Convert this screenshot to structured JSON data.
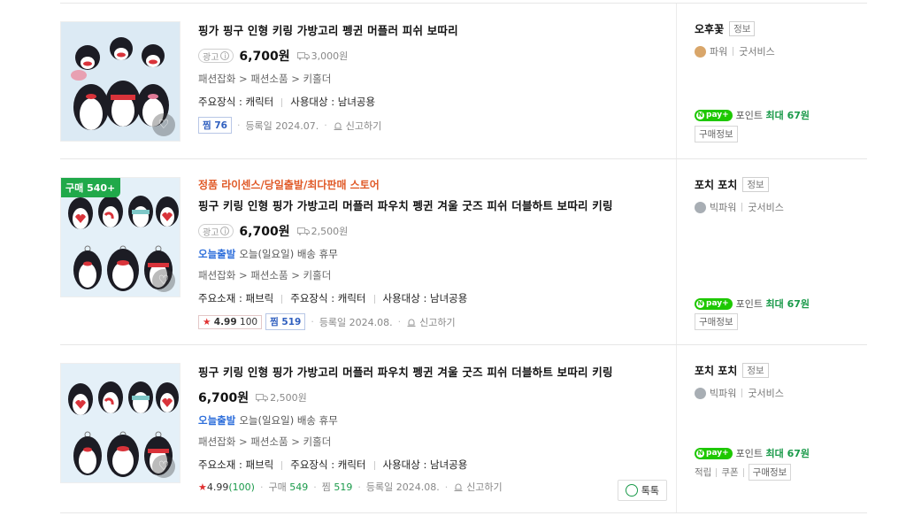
{
  "products": [
    {
      "thumb_badge": "",
      "promo": "",
      "title": "핑가 핑구 인형 키링 가방고리 펭귄 머플러 피쉬 보따리",
      "ad_label": "광고",
      "price": "6,700원",
      "shipping": "3,000원",
      "delivery_tag": "",
      "delivery_text": "",
      "category": "패션잡화 > 패션소품 > 키홀더",
      "attributes": [
        "주요장식 : 캐릭터",
        "사용대상 : 남녀공용"
      ],
      "rating": "",
      "rating_count": "",
      "zzim": "찜 76",
      "registered": "등록일 2024.07.",
      "report": "신고하기",
      "seller": {
        "name": "오후꽃",
        "info_label": "정보",
        "power": "파워",
        "service": "굿서비스",
        "medal": "bronze",
        "npay_label": "pay",
        "point_label": "포인트",
        "point_max": "최대 67원",
        "buy_info": "구매정보"
      }
    },
    {
      "thumb_badge": "구매 540+",
      "promo": "정품 라이센스/당일출발/최다판매 스토어",
      "title": "핑구 키링 인형 핑가 가방고리 머플러 파우치 펭귄 겨울 굿즈 피쉬 더블하트 보따리 키링",
      "ad_label": "광고",
      "price": "6,700원",
      "shipping": "2,500원",
      "delivery_tag": "오늘출발",
      "delivery_text": "오늘(일요일) 배송 휴무",
      "category": "패션잡화 > 패션소품 > 키홀더",
      "attributes": [
        "주요소재 : 패브릭",
        "주요장식 : 캐릭터",
        "사용대상 : 남녀공용"
      ],
      "rating": "4.99",
      "rating_count": "100",
      "zzim": "찜 519",
      "registered": "등록일 2024.08.",
      "report": "신고하기",
      "seller": {
        "name": "포치 포치",
        "info_label": "정보",
        "power": "빅파워",
        "service": "굿서비스",
        "medal": "silver",
        "npay_label": "pay",
        "point_label": "포인트",
        "point_max": "최대 67원",
        "buy_info": "구매정보"
      }
    },
    {
      "thumb_badge": "",
      "promo": "",
      "title": "핑구 키링 인형 핑가 가방고리 머플러 파우치 펭귄 겨울 굿즈 피쉬 더블하트 보따리 키링",
      "ad_label": "",
      "price": "6,700원",
      "shipping": "2,500원",
      "delivery_tag": "오늘출발",
      "delivery_text": "오늘(일요일) 배송 휴무",
      "category": "패션잡화 > 패션소품 > 키홀더",
      "attributes": [
        "주요소재 : 패브릭",
        "주요장식 : 캐릭터",
        "사용대상 : 남녀공용"
      ],
      "rating": "4.99",
      "rating_count": "(100)",
      "purchase_label": "구매",
      "purchase_count": "549",
      "zzim_label": "찜",
      "zzim_count": "519",
      "registered": "등록일 2024.08.",
      "report": "신고하기",
      "talk_label": "톡톡",
      "seller": {
        "name": "포치 포치",
        "info_label": "정보",
        "power": "빅파워",
        "service": "굿서비스",
        "medal": "silver",
        "npay_label": "pay",
        "point_label": "포인트",
        "point_max": "최대 67원",
        "links": [
          "적립",
          "쿠폰",
          "구매정보"
        ]
      }
    }
  ],
  "colors": {
    "price": "#111111",
    "point": "#1a9a4a",
    "delivery_tag": "#2f6fdb",
    "promo": "#e05a28",
    "badge": "#20a94a"
  }
}
